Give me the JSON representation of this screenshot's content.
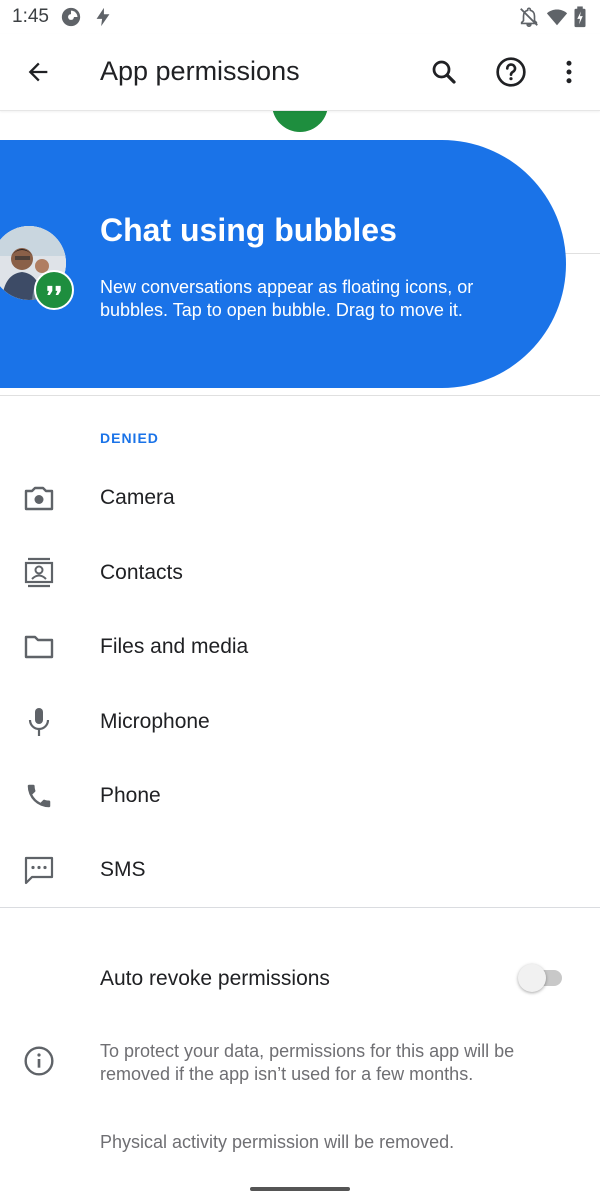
{
  "status_bar": {
    "time": "1:45",
    "icons": [
      "data-saver-icon",
      "lightning-icon",
      "notifications-off-icon",
      "wifi-icon",
      "battery-charging-icon"
    ]
  },
  "app_bar": {
    "title": "App permissions",
    "back_icon": "arrow-back-icon",
    "search_icon": "search-icon",
    "help_icon": "help-icon",
    "menu_icon": "more-vert-icon"
  },
  "bubble": {
    "title": "Chat using bubbles",
    "description": "New conversations appear as floating icons, or bubbles. Tap to open bubble. Drag to move it.",
    "badge_icon": "chat-quote-icon",
    "color": "#1a73e8"
  },
  "denied": {
    "header": "DENIED",
    "items": [
      {
        "label": "Camera",
        "icon": "camera-icon"
      },
      {
        "label": "Contacts",
        "icon": "contacts-icon"
      },
      {
        "label": "Files and media",
        "icon": "folder-icon"
      },
      {
        "label": "Microphone",
        "icon": "microphone-icon"
      },
      {
        "label": "Phone",
        "icon": "phone-icon"
      },
      {
        "label": "SMS",
        "icon": "sms-icon"
      }
    ]
  },
  "auto_revoke": {
    "label": "Auto revoke permissions",
    "enabled": false
  },
  "info": {
    "text": "To protect your data, permissions for this app will be removed if the app isn’t used for a few months.",
    "icon": "info-icon"
  },
  "activity_note": "Physical activity permission will be removed.",
  "colors": {
    "accent": "#1a73e8",
    "badge_green": "#1e8e3e",
    "secondary_text": "#6f6f73"
  }
}
